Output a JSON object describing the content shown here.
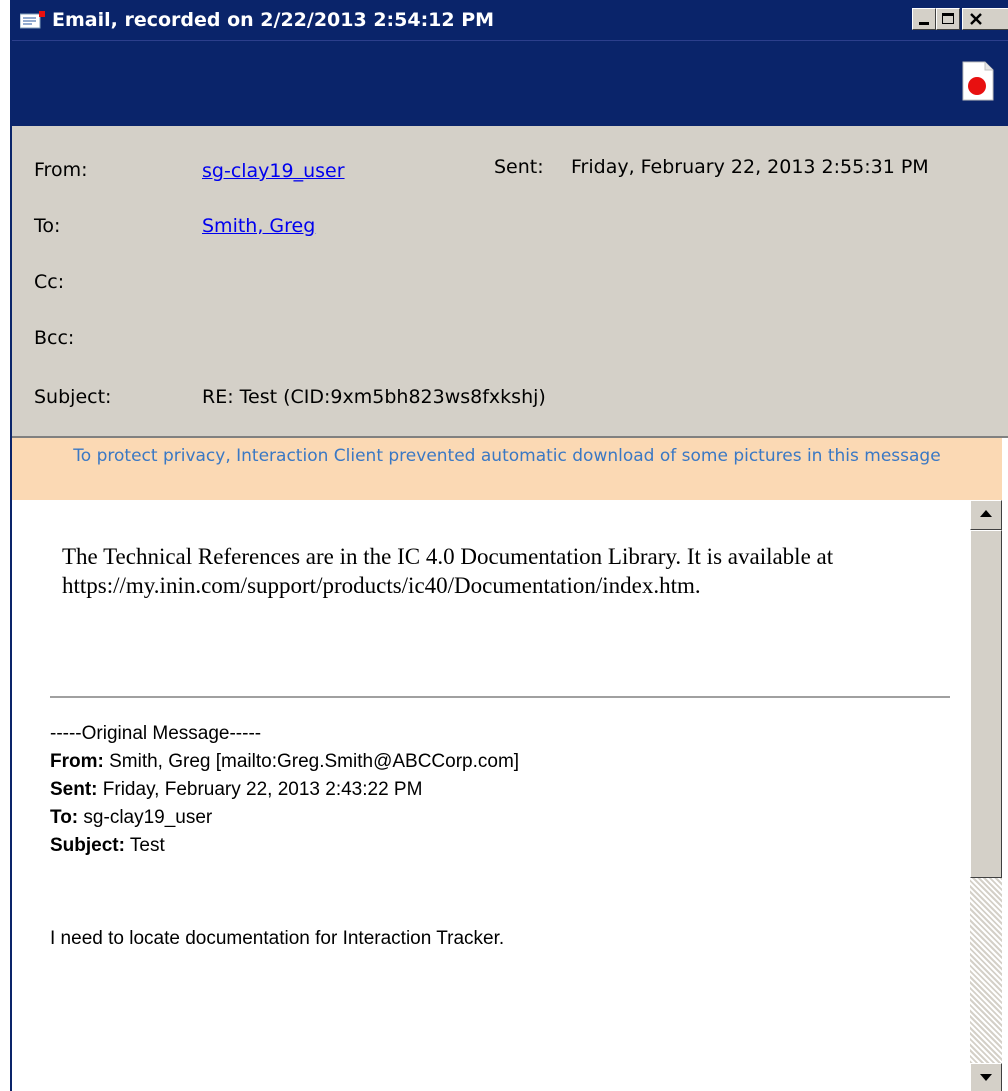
{
  "window": {
    "title": "Email,  recorded on 2/22/2013 2:54:12 PM",
    "icons": {
      "title": "email-icon",
      "record": "record-icon"
    },
    "colors": {
      "titlebar": "#0a246a",
      "record": "#e81010"
    }
  },
  "header": {
    "from_label": "From:",
    "from_value": "sg-clay19_user",
    "sent_label": "Sent:",
    "sent_value": "Friday, February 22, 2013 2:55:31 PM",
    "to_label": "To:",
    "to_value": "Smith, Greg",
    "cc_label": "Cc:",
    "cc_value": "",
    "bcc_label": "Bcc:",
    "bcc_value": "",
    "subject_label": "Subject:",
    "subject_value": "RE: Test (CID:9xm5bh823ws8fxkshj)"
  },
  "privacy_notice": "To protect privacy, Interaction Client prevented automatic download of some pictures in this message",
  "reply": {
    "text": "The Technical References are in the IC 4.0 Documentation Library. It is available  at https://my.inin.com/support/products/ic40/Documentation/index.htm."
  },
  "original": {
    "heading": "-----Original Message-----",
    "from_label": "From:",
    "from_value": " Smith, Greg  [mailto:Greg.Smith@ABCCorp.com]",
    "sent_label": "Sent:",
    "sent_value": " Friday, February 22, 2013 2:43:22 PM",
    "to_label": "To:",
    "to_value": " sg-clay19_user",
    "subject_label": "Subject:",
    "subject_value": " Test",
    "body": "I need to locate documentation for Interaction Tracker."
  },
  "scrollbar": {
    "up_icon": "arrow-up-icon",
    "down_icon": "arrow-down-icon"
  }
}
